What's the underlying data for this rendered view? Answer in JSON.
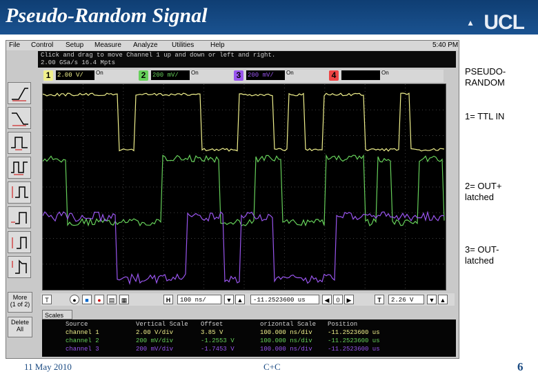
{
  "slide": {
    "title": "Pseudo-Random Signal",
    "logo": "UCL",
    "date": "11 May 2010",
    "footer_center": "C+C",
    "page_number": "6"
  },
  "colors": {
    "header_bg": "#1a5290",
    "ch1": "#f0f08c",
    "ch2": "#66d05a",
    "ch3": "#9955ee"
  },
  "scope": {
    "menu": [
      "File",
      "Control",
      "Setup",
      "Measure",
      "Analyze",
      "Utilities",
      "Help"
    ],
    "time": "5:40 PM",
    "status_line1": "Click and drag to move Channel 1 up and down or left and right.",
    "status_line2": "2.00 GSa/s     16.4 Mpts",
    "channels": [
      {
        "num": "1",
        "scale": "2.00 V/",
        "color": "#f0f08c"
      },
      {
        "num": "2",
        "scale": "200 mV/",
        "color": "#66d05a"
      },
      {
        "num": "3",
        "scale": "200 mV/",
        "color": "#9955ee"
      },
      {
        "num": "4",
        "scale": "",
        "color": "#ee4444"
      }
    ],
    "chan_mini": "On",
    "buttons": {
      "more": "More\n(1 of 2)",
      "delete_all": "Delete\nAll"
    },
    "horiz": {
      "timebase": "100 ns/",
      "position": "-11.2523600 us",
      "trigger": "2.26 V"
    },
    "scales_tab": "Scales",
    "measurements": {
      "headers": [
        "Source",
        "Vertical Scale",
        "Offset",
        "orizontal Scale",
        "Position"
      ],
      "rows": [
        [
          "channel 1",
          "2.00 V/div",
          "3.85 V",
          "100.000 ns/div",
          "-11.2523600 us"
        ],
        [
          "channel 2",
          "200 mV/div",
          "-1.2553 V",
          "100.000 ns/div",
          "-11.2523600 us"
        ],
        [
          "channel 3",
          "200 mV/div",
          "-1.7453 V",
          "100.000 ns/div",
          "-11.2523600 us"
        ]
      ]
    }
  },
  "annotations": [
    {
      "line1": "PSEUDO-",
      "line2": "RANDOM"
    },
    {
      "line1": "1= TTL IN",
      "line2": ""
    },
    {
      "line1": "2= OUT+",
      "line2": "latched"
    },
    {
      "line1": "3= OUT-",
      "line2": "latched"
    }
  ]
}
